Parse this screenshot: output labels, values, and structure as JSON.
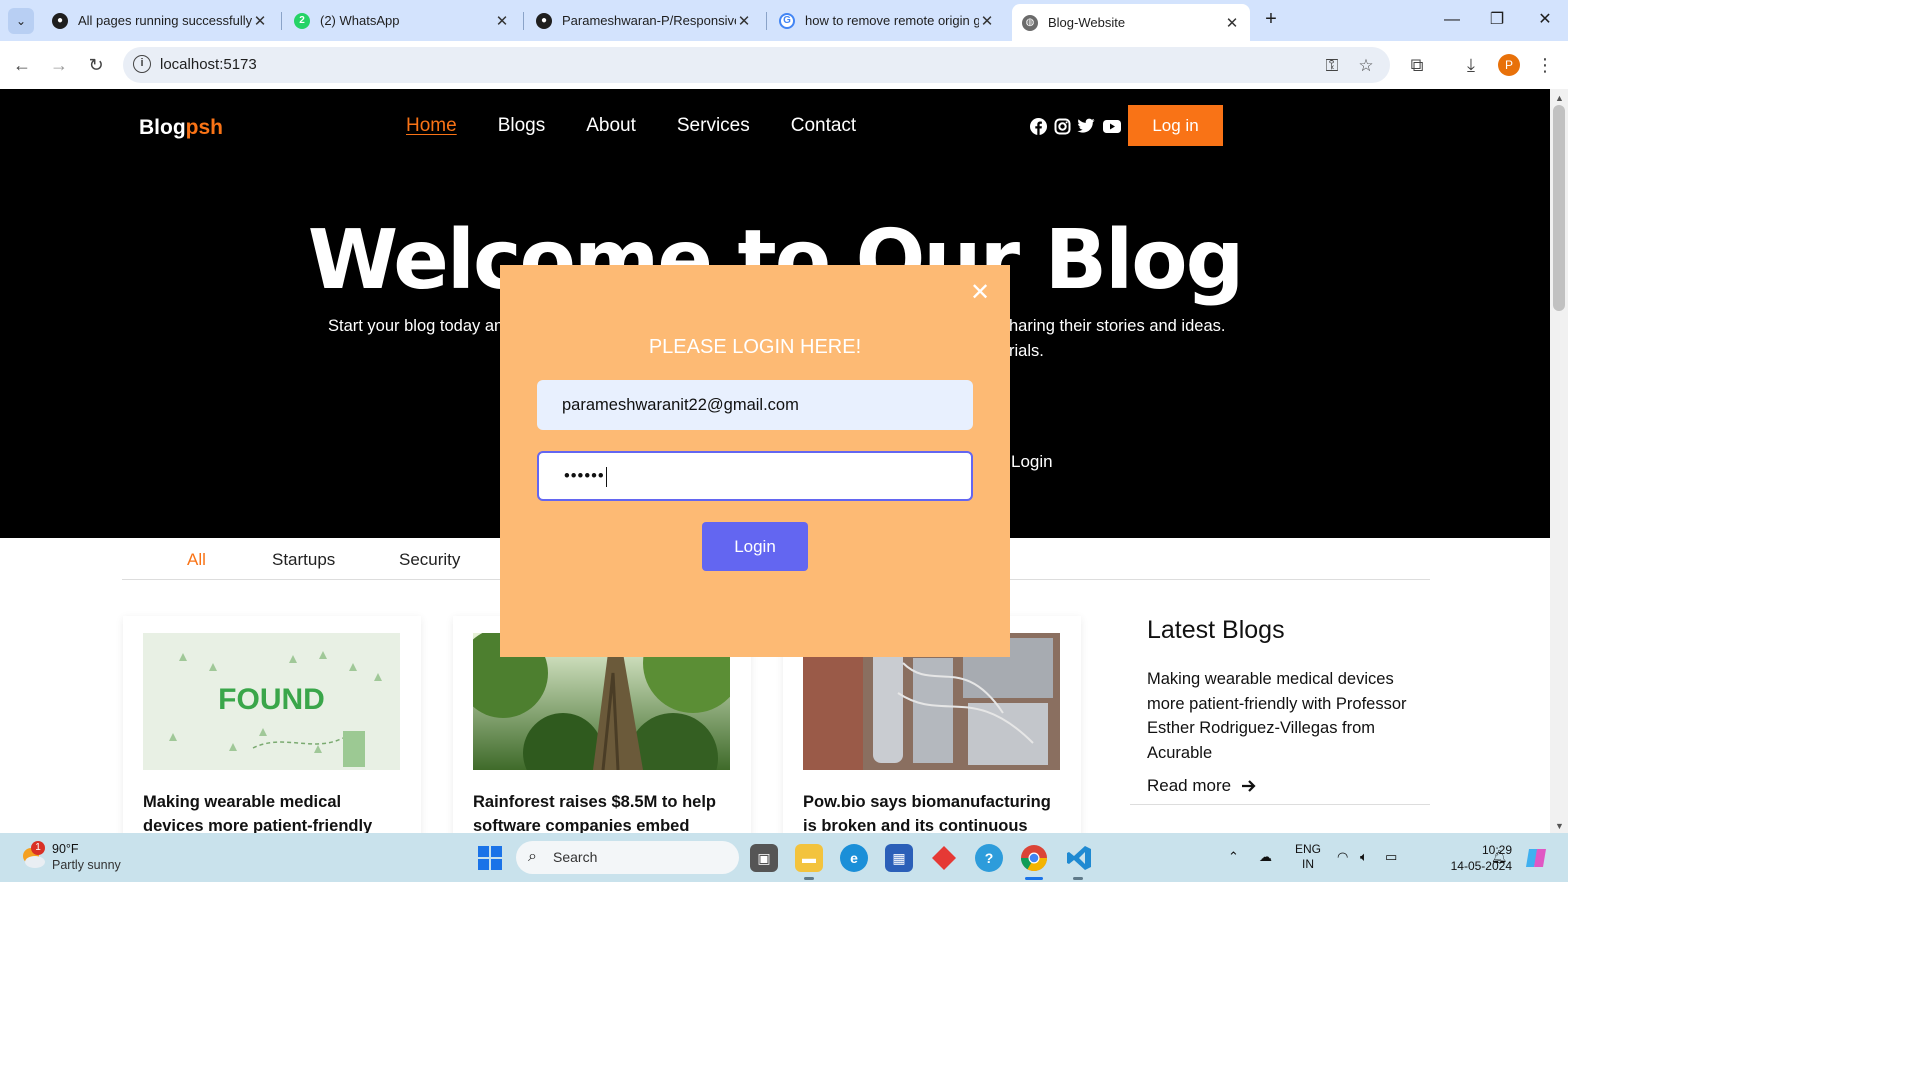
{
  "browser": {
    "tabs": [
      {
        "title": "All pages running successfully ·",
        "favicon": "github-icon"
      },
      {
        "title": "(2) WhatsApp",
        "favicon": "whatsapp-icon",
        "badge": "2"
      },
      {
        "title": "Parameshwaran-P/Responsive-I",
        "favicon": "github-icon"
      },
      {
        "title": "how to remove remote origin g",
        "favicon": "google-icon"
      },
      {
        "title": "Blog-Website",
        "favicon": "globe-icon",
        "active": true
      }
    ],
    "url": "localhost:5173",
    "profile_initial": "P"
  },
  "site": {
    "logo_main": "Blog",
    "logo_accent": "psh",
    "nav": [
      "Home",
      "Blogs",
      "About",
      "Services",
      "Contact"
    ],
    "login_button": "Log in",
    "hero_title": "Welcome to Our Blog",
    "hero_text_left": "Start your blog today an",
    "hero_text_right_1": "haring their stories and ideas.",
    "hero_text_right_2": "rials.",
    "hero_login_text": "Login",
    "categories": [
      "All",
      "Startups",
      "Security"
    ],
    "cards": [
      {
        "title": "Making wearable medical devices more patient-friendly",
        "image_text": "FOUND"
      },
      {
        "title": "Rainforest raises $8.5M to help software companies embed",
        "image_text": ""
      },
      {
        "title": "Pow.bio says biomanufacturing is broken and its continuous",
        "image_text": ""
      }
    ],
    "latest": {
      "heading": "Latest Blogs",
      "item": "Making wearable medical devices more patient-friendly with Professor Esther Rodriguez-Villegas from Acurable",
      "read_more": "Read more"
    },
    "colors": {
      "accent": "#f97316",
      "modal_bg": "#fdba74",
      "button": "#6366f1"
    }
  },
  "modal": {
    "title": "PLEASE LOGIN HERE!",
    "email_value": "parameshwaranit22@gmail.com",
    "password_mask": "••••••",
    "login_button": "Login",
    "close_glyph": "✕"
  },
  "taskbar": {
    "weather_temp": "90°F",
    "weather_desc": "Partly sunny",
    "weather_badge": "1",
    "search_placeholder": "Search",
    "lang_1": "ENG",
    "lang_2": "IN",
    "time": "10:29",
    "date": "14-05-2024"
  }
}
